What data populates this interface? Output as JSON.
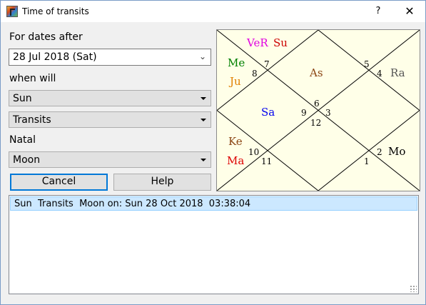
{
  "window": {
    "title": "Time of transits",
    "help_glyph": "?",
    "close_glyph": "✕"
  },
  "form": {
    "dates_label": "For dates after",
    "date_value": "28 Jul 2018  (Sat)",
    "when_label": "when will",
    "planet_value": "Sun",
    "event_value": "Transits",
    "natal_label": "Natal",
    "natal_value": "Moon",
    "cancel_label": "Cancel",
    "help_label": "Help"
  },
  "chart": {
    "houses": {
      "h1": "6",
      "h2": "5",
      "h3": "4",
      "h4": "3",
      "h5": "2",
      "h6": "1",
      "h7": "12",
      "h8": "11",
      "h9": "10",
      "h10": "9",
      "h11": "8",
      "h12": "7"
    },
    "planets": {
      "ver": {
        "label": "VeR",
        "color": "#e000e0"
      },
      "su": {
        "label": "Su",
        "color": "#cc0000"
      },
      "me": {
        "label": "Me",
        "color": "#008000"
      },
      "ju": {
        "label": "Ju",
        "color": "#e08000"
      },
      "as": {
        "label": "As",
        "color": "#8b4513"
      },
      "ra": {
        "label": "Ra",
        "color": "#555555"
      },
      "sa": {
        "label": "Sa",
        "color": "#0000ee"
      },
      "ke": {
        "label": "Ke",
        "color": "#8b4513"
      },
      "ma": {
        "label": "Ma",
        "color": "#dd0000"
      },
      "mo": {
        "label": "Mo",
        "color": "#000000"
      }
    }
  },
  "results": [
    "Sun  Transits  Moon on: Sun 28 Oct 2018  03:38:04"
  ]
}
